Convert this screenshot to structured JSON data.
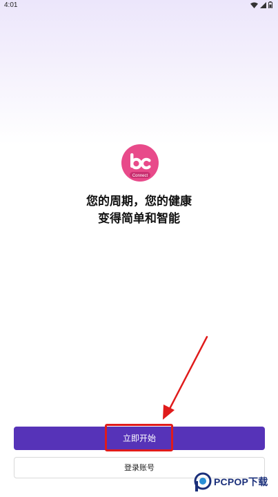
{
  "status_bar": {
    "time": "4:01",
    "icons": [
      "wifi-icon",
      "signal-icon",
      "battery-icon"
    ]
  },
  "logo": {
    "icon": "bc-connect-logo",
    "caption": "Connect",
    "color": "#e84a8a"
  },
  "slogan": {
    "line1": "您的周期，您的健康",
    "line2": "变得简单和智能"
  },
  "actions": {
    "start_label": "立即开始",
    "login_label": "登录账号"
  },
  "annotation": {
    "arrow_color": "#e01b1b",
    "highlight_color": "#e01b1b"
  },
  "watermark": {
    "text": "PCPOP下载"
  },
  "colors": {
    "primary": "#5633b8",
    "background_top": "#ece6fb"
  }
}
